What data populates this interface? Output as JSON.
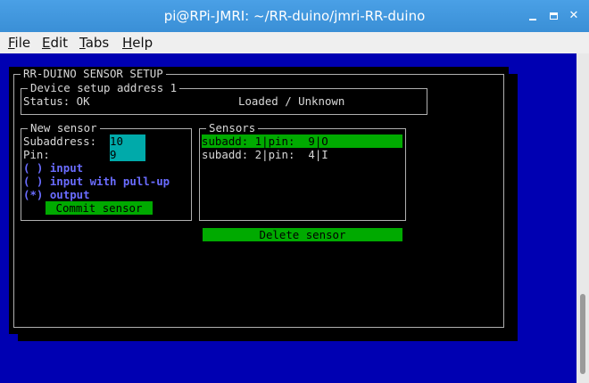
{
  "window": {
    "title": "pi@RPi-JMRI: ~/RR-duino/jmri-RR-duino",
    "controls": {
      "minimize": "minimize-icon",
      "maximize": "maximize-icon",
      "close": "close-icon",
      "close_glyph": "✕"
    }
  },
  "menu": {
    "items": [
      "File",
      "Edit",
      "Tabs",
      "Help"
    ]
  },
  "terminal": {
    "background": "#0000b2",
    "dialog_title": "RR-DUINO SENSOR SETUP",
    "device": {
      "title": "Device setup address 1",
      "status": "Status: OK",
      "state": "Loaded / Unknown"
    },
    "new_sensor": {
      "title": "New sensor",
      "subaddress_label": "Subaddress:",
      "subaddress_value": "10",
      "pin_label": "Pin:",
      "pin_value": "9",
      "options": [
        "( ) input",
        "( ) input with pull-up",
        "(*) output"
      ],
      "commit_label": "Commit sensor"
    },
    "sensors": {
      "title": "Sensors",
      "rows": [
        "subadd: 1|pin:  9|O",
        "subadd: 2|pin:  4|I"
      ],
      "selected_index": 0,
      "delete_label": "Delete sensor"
    },
    "colors": {
      "field": "#00aaaa",
      "button": "#00aa00",
      "option_text": "#6a6cff"
    }
  }
}
